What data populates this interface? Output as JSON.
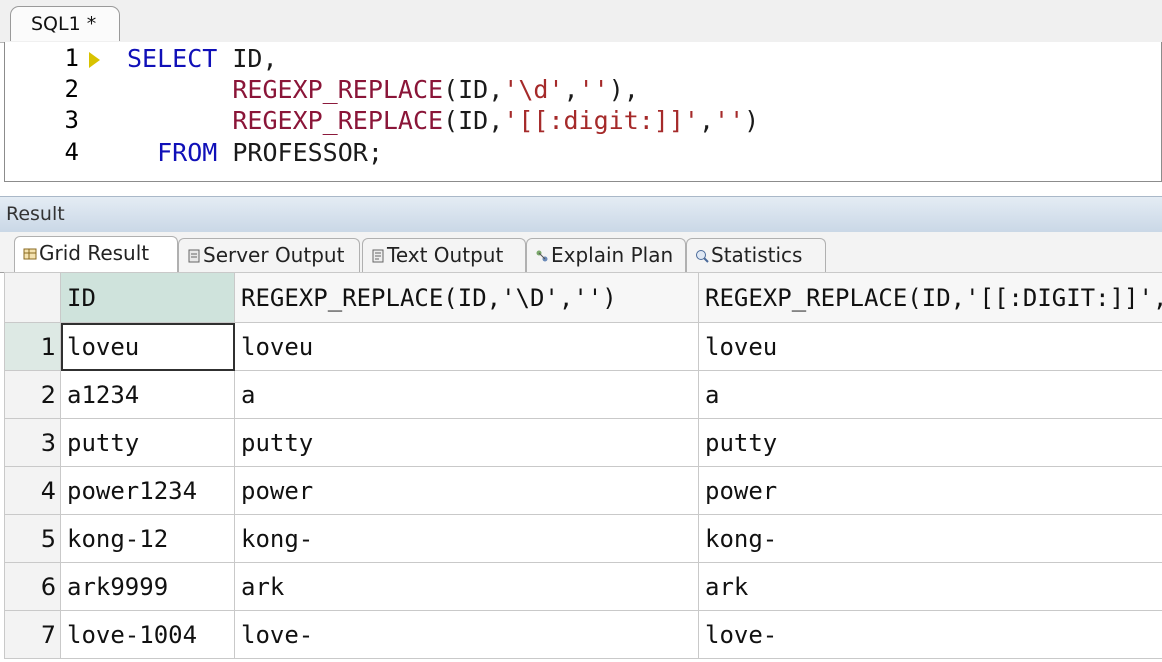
{
  "editor": {
    "tab_label": "SQL1 *",
    "line_numbers": [
      "1",
      "2",
      "3",
      "4"
    ],
    "lines": [
      {
        "indent": "",
        "parts": [
          {
            "t": "kw",
            "v": "SELECT"
          },
          {
            "t": "plain",
            "v": " ID,"
          }
        ]
      },
      {
        "indent": "       ",
        "parts": [
          {
            "t": "fn",
            "v": "REGEXP_REPLACE"
          },
          {
            "t": "plain",
            "v": "(ID,"
          },
          {
            "t": "str",
            "v": "'\\d'"
          },
          {
            "t": "plain",
            "v": ","
          },
          {
            "t": "str",
            "v": "''"
          },
          {
            "t": "plain",
            "v": "),"
          }
        ]
      },
      {
        "indent": "       ",
        "parts": [
          {
            "t": "fn",
            "v": "REGEXP_REPLACE"
          },
          {
            "t": "plain",
            "v": "(ID,"
          },
          {
            "t": "str",
            "v": "'[[:digit:]]'"
          },
          {
            "t": "plain",
            "v": ","
          },
          {
            "t": "str",
            "v": "''"
          },
          {
            "t": "plain",
            "v": ")"
          }
        ]
      },
      {
        "indent": "  ",
        "parts": [
          {
            "t": "kw",
            "v": "FROM"
          },
          {
            "t": "plain",
            "v": " PROFESSOR;"
          }
        ]
      }
    ]
  },
  "result": {
    "panel_title": "Result",
    "tabs": [
      {
        "label": "Grid Result",
        "icon": "grid-icon"
      },
      {
        "label": "Server Output",
        "icon": "server-output-icon"
      },
      {
        "label": "Text Output",
        "icon": "text-output-icon"
      },
      {
        "label": "Explain Plan",
        "icon": "explain-plan-icon"
      },
      {
        "label": "Statistics",
        "icon": "statistics-icon"
      }
    ],
    "columns": [
      "ID",
      "REGEXP_REPLACE(ID,'\\D','')",
      "REGEXP_REPLACE(ID,'[[:DIGIT:]]','')"
    ],
    "rows": [
      {
        "n": "1",
        "cells": [
          "loveu",
          "loveu",
          "loveu"
        ]
      },
      {
        "n": "2",
        "cells": [
          "a1234",
          "a",
          "a"
        ]
      },
      {
        "n": "3",
        "cells": [
          "putty",
          "putty",
          "putty"
        ]
      },
      {
        "n": "4",
        "cells": [
          "power1234",
          "power",
          "power"
        ]
      },
      {
        "n": "5",
        "cells": [
          "kong-12",
          "kong-",
          "kong-"
        ]
      },
      {
        "n": "6",
        "cells": [
          "ark9999",
          "ark",
          "ark"
        ]
      },
      {
        "n": "7",
        "cells": [
          "love-1004",
          "love-",
          "love-"
        ]
      }
    ]
  }
}
